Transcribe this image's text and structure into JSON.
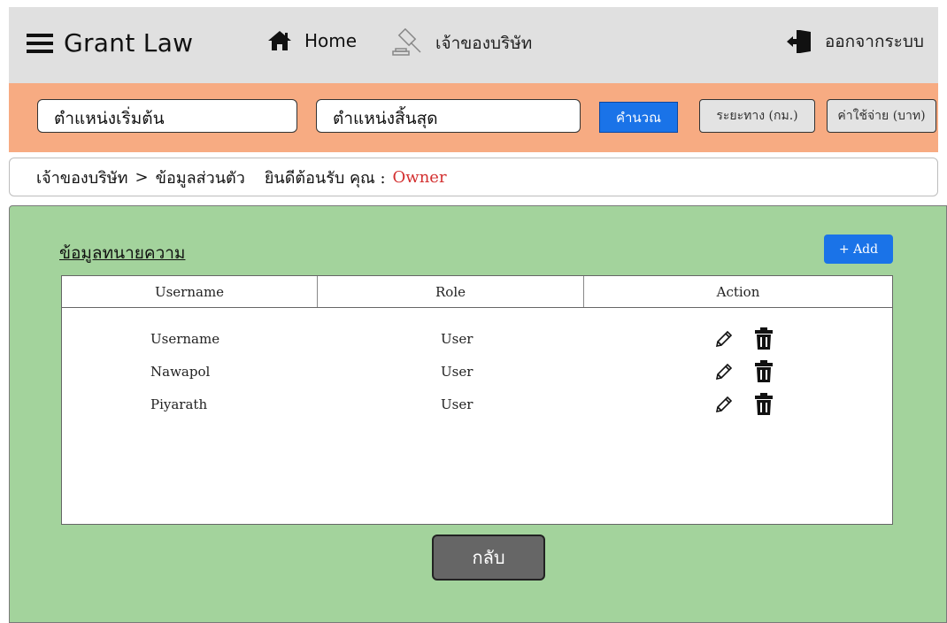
{
  "header": {
    "brand": "Grant Law",
    "home_label": "Home",
    "owner_label": "เจ้าของบริษัท",
    "logout_label": "ออกจากระบบ"
  },
  "route_bar": {
    "start_placeholder": "ตำแหน่งเริ่มต้น",
    "end_placeholder": "ตำแหน่งสิ้นสุด",
    "calculate_label": "คำนวณ",
    "distance_label": "ระยะทาง (กม.)",
    "cost_label": "ค่าใช้จ่าย (บาท)"
  },
  "breadcrumb": {
    "parent": "เจ้าของบริษัท",
    "separator": ">",
    "current": "ข้อมูลส่วนตัว",
    "welcome": "ยินดีต้อนรับ คุณ :",
    "user": "Owner"
  },
  "main": {
    "title": "ข้อมูลทนายความ",
    "add_label": "+ Add",
    "columns": [
      "Username",
      "Role",
      "Action"
    ],
    "rows": [
      {
        "username": "Username",
        "role": "User"
      },
      {
        "username": "Nawapol",
        "role": "User"
      },
      {
        "username": "Piyarath",
        "role": "User"
      }
    ],
    "back_label": "กลับ"
  },
  "icons": {
    "menu": "hamburger-icon",
    "home": "home-icon",
    "gavel": "gavel-icon",
    "logout": "logout-door-icon",
    "edit": "pencil-icon",
    "delete": "trash-icon"
  },
  "colors": {
    "topbar": "#e0e0e0",
    "route_bar": "#f7ab82",
    "main_bg": "#a3d39c",
    "primary": "#1a73e8",
    "owner_text": "#d32f2f",
    "back_button": "#666666"
  }
}
